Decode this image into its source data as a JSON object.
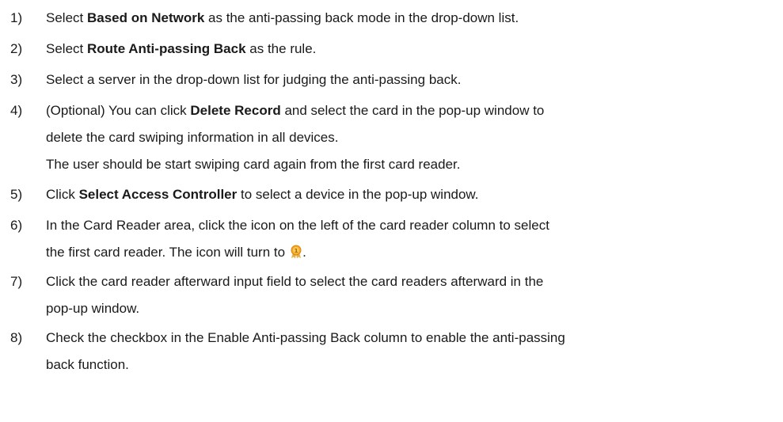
{
  "steps": [
    {
      "num": "1)",
      "pre": "Select ",
      "bold": "Based on Network",
      "post": " as the anti-passing back mode in the drop-down list."
    },
    {
      "num": "2)",
      "pre": "Select ",
      "bold": "Route Anti-passing Back",
      "post": " as the rule."
    },
    {
      "num": "3)",
      "text": "Select a server in the drop-down list for judging the anti-passing back."
    },
    {
      "num": "4)",
      "pre": "(Optional) You can click ",
      "bold": "Delete Record",
      "post": " and select the card in the pop-up window to",
      "line2": "delete the card swiping information in all devices.",
      "line3": "The user should be start swiping card again from the first card reader."
    },
    {
      "num": "5)",
      "pre": "Click ",
      "bold": "Select Access Controller",
      "post": " to select a device in the pop-up window."
    },
    {
      "num": "6)",
      "line1": "In the Card Reader area, click the icon on the left of the card reader column to select",
      "line2_pre": "the first card reader. The icon will turn to",
      "line2_post": ".",
      "icon": "first-card-reader-icon"
    },
    {
      "num": "7)",
      "line1": "Click the card reader afterward input field to select the card readers afterward in the",
      "line2": "pop-up window."
    },
    {
      "num": "8)",
      "line1": "Check the checkbox in the Enable Anti-passing Back column to enable the anti-passing",
      "line2": "back function."
    }
  ],
  "colors": {
    "text": "#1a1a1a",
    "icon_orange": "#f5a623",
    "icon_ribbon": "#e8b04a"
  }
}
